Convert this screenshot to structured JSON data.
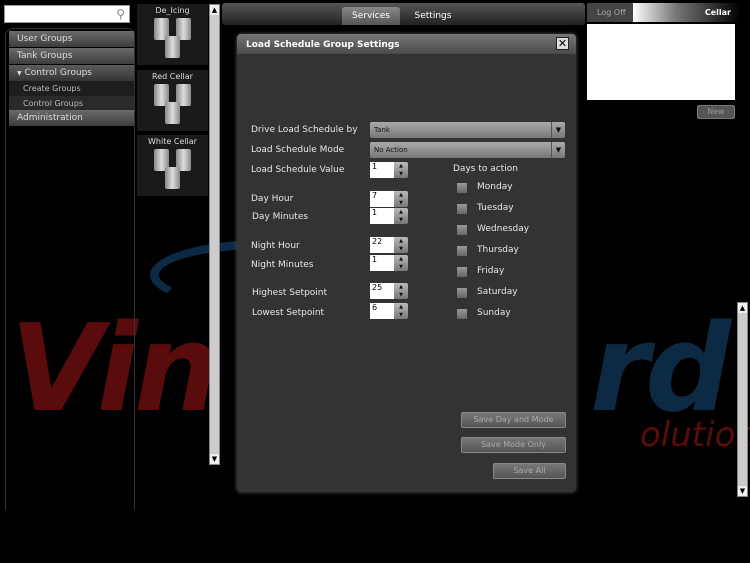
{
  "logo": {
    "text": "Vineyard Solutions",
    "visible_fragments": [
      "Vin",
      "rd",
      "olutions"
    ]
  },
  "search": {
    "placeholder": ""
  },
  "sidebar": {
    "items": [
      {
        "label": "User Groups"
      },
      {
        "label": "Tank Groups"
      },
      {
        "label": "Control Groups",
        "expanded": true
      },
      {
        "label": "Create Groups"
      },
      {
        "label": "Control Groups"
      },
      {
        "label": "Administration"
      }
    ]
  },
  "tanks": [
    {
      "name": "De_Icing"
    },
    {
      "name": "Red Cellar"
    },
    {
      "name": "White Cellar"
    }
  ],
  "topbar": {
    "tabs": [
      {
        "label": "Services",
        "active": true
      },
      {
        "label": "Settings"
      }
    ]
  },
  "user": {
    "logoff": "Log Off",
    "location": "Cellar",
    "new_label": "New"
  },
  "dialog": {
    "title": "Load Schedule Group Settings",
    "drive_label": "Drive Load Schedule by",
    "drive_value": "Tank",
    "mode_label": "Load Schedule Mode",
    "mode_value": "No Action",
    "fields": [
      {
        "label": "Load Schedule Value",
        "value": "1"
      },
      {
        "label": "Day Hour",
        "value": "7"
      },
      {
        "label": "Day Minutes",
        "value": "1"
      },
      {
        "label": "Night Hour",
        "value": "22"
      },
      {
        "label": "Night Minutes",
        "value": "1"
      },
      {
        "label": "Highest Setpoint",
        "value": "25"
      },
      {
        "label": "Lowest Setpoint",
        "value": "6"
      }
    ],
    "days_label": "Days to action",
    "days": [
      {
        "label": "Monday",
        "checked": false
      },
      {
        "label": "Tuesday",
        "checked": false
      },
      {
        "label": "Wednesday",
        "checked": false
      },
      {
        "label": "Thursday",
        "checked": false
      },
      {
        "label": "Friday",
        "checked": false
      },
      {
        "label": "Saturday",
        "checked": false
      },
      {
        "label": "Sunday",
        "checked": false
      }
    ],
    "buttons": {
      "save_day_mode": "Save Day and Mode",
      "save_mode_only": "Save Mode Only",
      "save_all": "Save All"
    }
  }
}
